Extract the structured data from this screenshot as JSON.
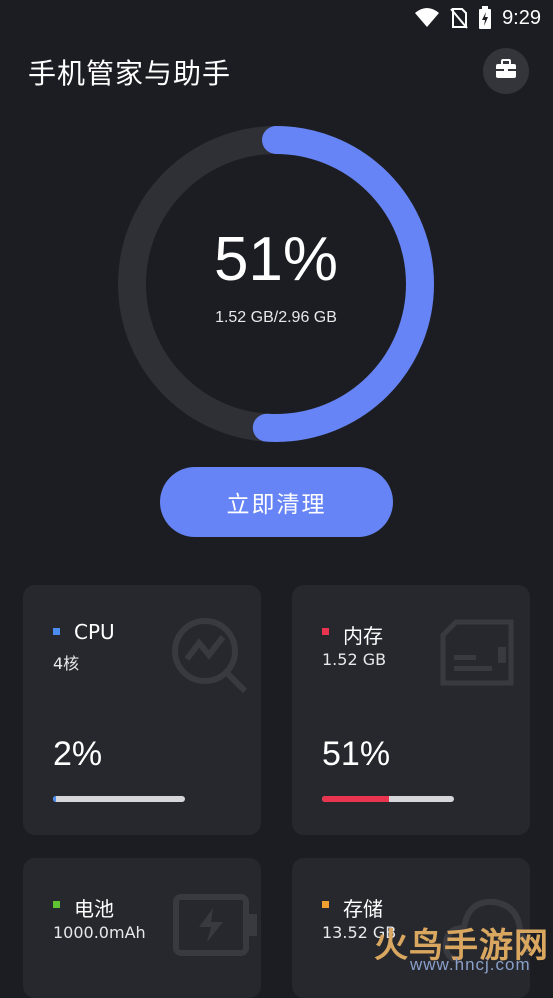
{
  "status_bar": {
    "time": "9:29",
    "icons": [
      "wifi-icon",
      "no-sim-icon",
      "battery-charging-icon"
    ]
  },
  "header": {
    "title": "手机管家与助手",
    "toolbox_icon": "briefcase-icon"
  },
  "memory_ring": {
    "percent_label": "51%",
    "percent_value": 51,
    "usage_text": "1.52 GB/2.96 GB",
    "track_color": "#2e3035",
    "progress_color": "#6684f5"
  },
  "clean_button": {
    "label": "立即清理"
  },
  "cards": {
    "cpu": {
      "name": "CPU",
      "detail": "4核",
      "value": "2%",
      "level": 0.02,
      "color": "#4a8cf0",
      "icon": "cpu-monitor-icon"
    },
    "ram": {
      "name": "内存",
      "detail": "1.52 GB",
      "value": "51%",
      "level": 0.51,
      "color": "#e8344e",
      "icon": "memory-card-icon"
    },
    "battery": {
      "name": "电池",
      "detail": "1000.0mAh",
      "color": "#5fc232",
      "icon": "battery-icon"
    },
    "storage": {
      "name": "存储",
      "detail": "13.52 GB",
      "color": "#f0a030",
      "icon": "cloud-icon"
    }
  },
  "watermark": {
    "logo_text": "火鸟手游网",
    "url": "www.hncj.com"
  }
}
